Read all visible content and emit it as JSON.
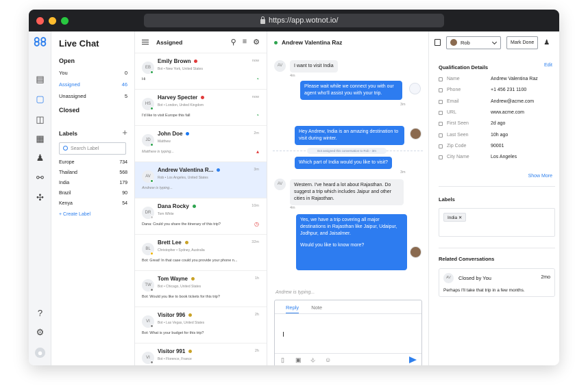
{
  "browser": {
    "url": "https://app.wotnot.io/"
  },
  "nav": {
    "title": "Live Chat",
    "open_label": "Open",
    "open_items": [
      {
        "label": "You",
        "count": "0"
      },
      {
        "label": "Assigned",
        "count": "46"
      },
      {
        "label": "Unassigned",
        "count": "5"
      }
    ],
    "closed_label": "Closed",
    "labels_title": "Labels",
    "search_placeholder": "Search Label",
    "labels": [
      {
        "label": "Europe",
        "count": "734"
      },
      {
        "label": "Thailand",
        "count": "568"
      },
      {
        "label": "India",
        "count": "179"
      },
      {
        "label": "Brazil",
        "count": "90"
      },
      {
        "label": "Kenya",
        "count": "54"
      }
    ],
    "create_label": "+ Create Label"
  },
  "list": {
    "title": "Assigned",
    "conversations": [
      {
        "initials": "EB",
        "name": "Emily Brown",
        "sub": "Bot • New York, United States",
        "time": "now",
        "msg": "Hi",
        "status_color": "#2ea44f",
        "badge_color": "#e03b3b",
        "indicator": "◔",
        "indicator_color": "#2ea44f"
      },
      {
        "initials": "HS",
        "name": "Harvey Specter",
        "sub": "Bot • London, United Kingdom",
        "time": "now",
        "msg": "I'd like to visit Europe this fall",
        "status_color": "#2ea44f",
        "badge_color": "#e03b3b",
        "indicator": "◔",
        "indicator_color": "#2ea44f"
      },
      {
        "initials": "JD",
        "name": "John Doe",
        "sub": "Matthew",
        "time": "2m",
        "msg": "Matthew is typing...",
        "status_color": "#2ea44f",
        "badge_color": "#1877f2",
        "indicator": "▴",
        "indicator_color": "#e03b3b"
      },
      {
        "initials": "AV",
        "name": "Andrew Valentina R...",
        "sub": "Rob • Los Angeles, United States",
        "time": "3m",
        "msg": "Andrew is typing...",
        "status_color": "#2ea44f",
        "badge_color": "#2f80ed",
        "indicator": "",
        "indicator_color": ""
      },
      {
        "initials": "DR",
        "name": "Dana Rocky",
        "sub": "Tom White",
        "time": "10m",
        "msg": "Dana: Could you share the itinerary of this trip?",
        "status_color": "#cccccc",
        "badge_color": "#2ea44f",
        "indicator": "◷",
        "indicator_color": "#e03b3b"
      },
      {
        "initials": "BL",
        "name": "Brett Lee",
        "sub": "Christopher • Sydney, Australia",
        "time": "32m",
        "msg": "Bot: Great! In that case could you provide your phone n...",
        "status_color": "#f0b400",
        "badge_color": "#c9a227",
        "indicator": "",
        "indicator_color": ""
      },
      {
        "initials": "TW",
        "name": "Tom Wayne",
        "sub": "Bot • Chicago, United States",
        "time": "1h",
        "msg": "Bot: Would you like to book tickets for this trip?",
        "status_color": "#888888",
        "badge_color": "#c9a227",
        "indicator": "",
        "indicator_color": ""
      },
      {
        "initials": "VI",
        "name": "Visitor 996",
        "sub": "Bot • Las Vegas, United States",
        "time": "2h",
        "msg": "Bot: What is your budget for this trip?",
        "status_color": "#888888",
        "badge_color": "#c9a227",
        "indicator": "",
        "indicator_color": ""
      },
      {
        "initials": "VI",
        "name": "Visitor 991",
        "sub": "Bot • Florence, France",
        "time": "2h",
        "msg": "",
        "status_color": "#888888",
        "badge_color": "#c9a227",
        "indicator": "",
        "indicator_color": ""
      }
    ]
  },
  "chat": {
    "name": "Andrew Valentina Raz",
    "visitor_initials": "AV",
    "messages": [
      {
        "text": "I want to visit India",
        "time": "4m"
      },
      {
        "text": "Please wait while we connect you with our agent who'll assist you with your trip.",
        "time": "3m"
      },
      {
        "text": "Bot assigned this conversation to Rob - 3m"
      },
      {
        "text": "Hey Andrew, India is an amazing destination to visit during winter."
      },
      {
        "text": "Which part of India would you like to visit?",
        "time": "3m"
      },
      {
        "text": "Western. I've heard a lot about Rajasthan. Do suggest a trip which includes Jaipur and other cities in Rajasthan.",
        "time": "4m"
      },
      {
        "text": "Yes, we have a trip covering all major destinations in Rajasthan like Jaipur, Udaipur, Jodhpur, and Jaisalmer.",
        "text2": "Would you like to know more?",
        "time": "2m"
      }
    ],
    "typing": "Andrew is typing...",
    "reply_tab": "Reply",
    "note_tab": "Note"
  },
  "details": {
    "agent": "Rob",
    "mark_done": "Mark Done",
    "qualification_title": "Qualification Details",
    "edit": "Edit",
    "fields": [
      {
        "key": "Name",
        "value": "Andrew Valentina Raz"
      },
      {
        "key": "Phone",
        "value": "+1 456 231 1100"
      },
      {
        "key": "Email",
        "value": "Andrew@acme.com"
      },
      {
        "key": "URL",
        "value": "www.acme.com"
      },
      {
        "key": "First Seen",
        "value": "2d ago"
      },
      {
        "key": "Last Seen",
        "value": "10h ago"
      },
      {
        "key": "Zip Code",
        "value": "90001"
      },
      {
        "key": "City Name",
        "value": "Los Angeles"
      }
    ],
    "show_more": "Show More",
    "labels_title": "Labels",
    "label_chip": "India",
    "related_title": "Related Conversations",
    "related": {
      "initials": "AV",
      "title": "Closed by You",
      "time": "2mo",
      "msg": "Perhaps I'll take that trip in a few months."
    }
  }
}
